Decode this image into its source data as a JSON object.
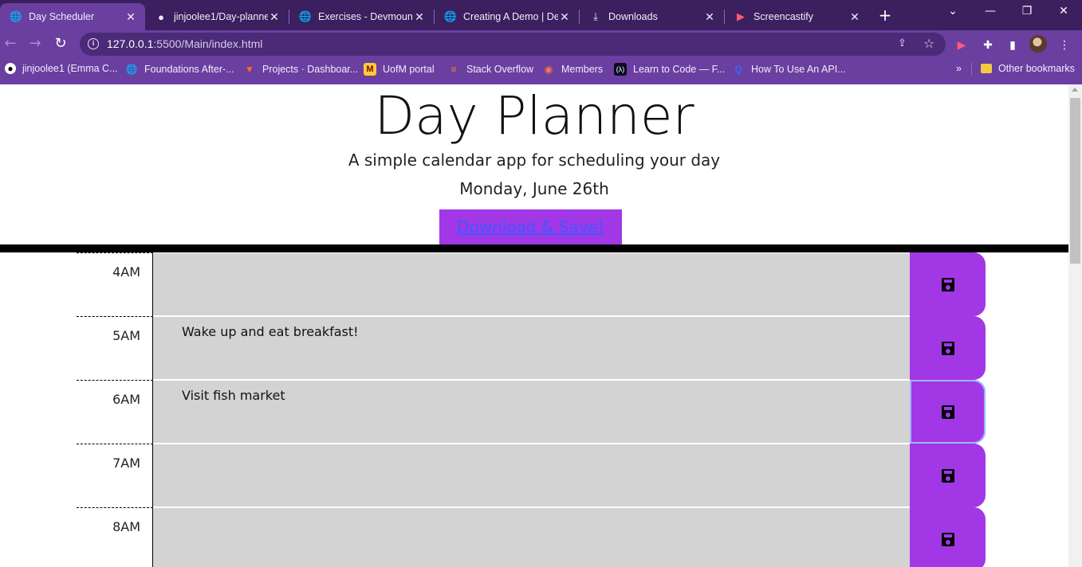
{
  "browser": {
    "tabs": [
      {
        "title": "Day Scheduler",
        "icon": "globe-icon",
        "active": true
      },
      {
        "title": "jinjoolee1/Day-planne",
        "icon": "github-icon"
      },
      {
        "title": "Exercises - Devmount",
        "icon": "globe-icon"
      },
      {
        "title": "Creating A Demo | De",
        "icon": "globe-icon"
      },
      {
        "title": "Downloads",
        "icon": "download-icon"
      },
      {
        "title": "Screencastify",
        "icon": "screencastify-icon"
      }
    ],
    "url_host": "127.0.0.1",
    "url_path": ":5500/Main/index.html",
    "bookmarks": [
      {
        "label": "jinjoolee1 (Emma C...",
        "icon": "github-icon"
      },
      {
        "label": "Foundations After-...",
        "icon": "globe-icon"
      },
      {
        "label": "Projects · Dashboar...",
        "icon": "gitlab-icon"
      },
      {
        "label": "UofM portal",
        "icon": "umn-icon"
      },
      {
        "label": "Stack Overflow",
        "icon": "stackoverflow-icon"
      },
      {
        "label": "Members",
        "icon": "members-icon"
      },
      {
        "label": "Learn to Code — F...",
        "icon": "freecodecamp-icon"
      },
      {
        "label": "How To Use An API...",
        "icon": "rapidapi-icon"
      }
    ],
    "other_bookmarks": "Other bookmarks",
    "more_bookmarks": "»"
  },
  "page": {
    "title": "Day Planner",
    "lead": "A simple calendar app for scheduling your day",
    "current_day": "Monday, June 26th",
    "download_label": "Download & Save!",
    "colors": {
      "accent": "#a237e6",
      "row": "#d3d3d3"
    },
    "time_blocks": [
      {
        "hour": "4AM",
        "text": ""
      },
      {
        "hour": "5AM",
        "text": "Wake up and eat breakfast!"
      },
      {
        "hour": "6AM",
        "text": "Visit fish market"
      },
      {
        "hour": "7AM",
        "text": ""
      },
      {
        "hour": "8AM",
        "text": ""
      }
    ]
  }
}
